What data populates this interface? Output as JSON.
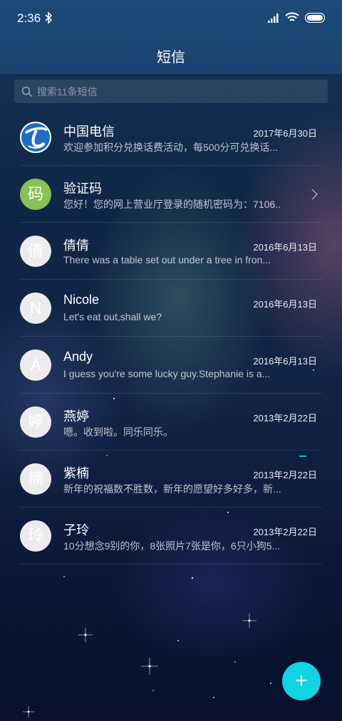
{
  "status_bar": {
    "time": "2:36",
    "icons": [
      "bluetooth-icon",
      "signal-icon",
      "wifi-icon",
      "battery-icon"
    ]
  },
  "header": {
    "title": "短信"
  },
  "search": {
    "placeholder": "搜索11条短信",
    "value": "",
    "icon": "search-icon"
  },
  "conversations": [
    {
      "name": "中国电信",
      "date": "2017年6月30日",
      "snippet": "欢迎参加积分兑换话费活动，每500分可兑换话...",
      "avatar": "china-telecom-logo"
    },
    {
      "name": "验证码",
      "date": "",
      "snippet": "您好！您的网上营业厅登录的随机密码为：7106...",
      "avatar_char": "码",
      "avatar_color": "#86c254",
      "chevron": "chevron-right-icon"
    },
    {
      "name": "倩倩",
      "date": "2016年6月13日",
      "snippet": "There was a table set out under a tree in fron...",
      "avatar_char": "倩"
    },
    {
      "name": "Nicole",
      "date": "2016年6月13日",
      "snippet": "Let's eat out,shall we?",
      "avatar_char": "N"
    },
    {
      "name": "Andy",
      "date": "2016年6月13日",
      "snippet": "I guess you're some lucky guy.Stephanie is a...",
      "avatar_char": "A"
    },
    {
      "name": "燕婷",
      "date": "2013年2月22日",
      "snippet": "嗯。收到啦。同乐同乐。",
      "avatar_char": "婷"
    },
    {
      "name": "紫楠",
      "date": "2013年2月22日",
      "snippet": "新年的祝福数不胜数，新年的愿望好多好多，新...",
      "avatar_char": "楠"
    },
    {
      "name": "子玲",
      "date": "2013年2月22日",
      "snippet": "10分想念9别的你，8张照片7张是你，6只小狗5...",
      "avatar_char": "玲"
    }
  ],
  "fab": {
    "label": "+",
    "icon": "plus-icon",
    "color": "#0fd4e5"
  }
}
